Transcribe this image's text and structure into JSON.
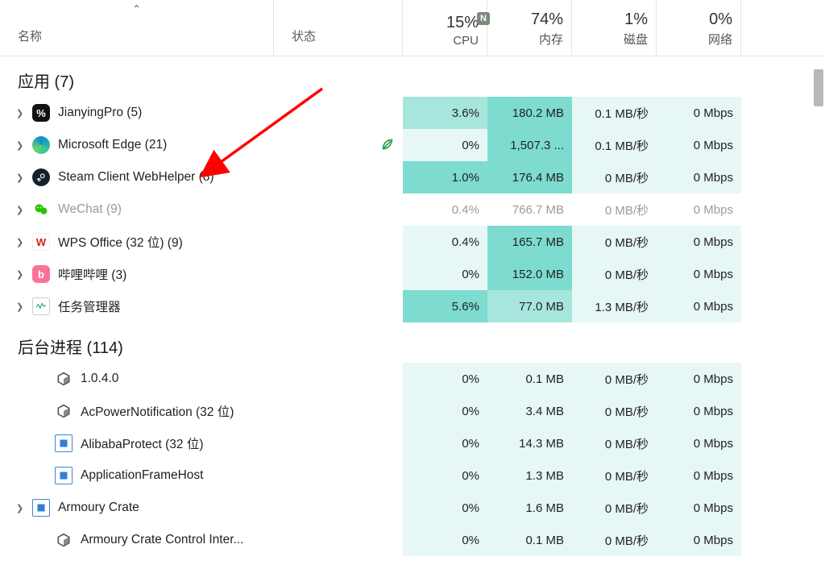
{
  "columns": {
    "name": "名称",
    "status": "状态",
    "cpu": {
      "pct": "15%",
      "label": "CPU",
      "badge": "N"
    },
    "mem": {
      "pct": "74%",
      "label": "内存"
    },
    "disk": {
      "pct": "1%",
      "label": "磁盘"
    },
    "net": {
      "pct": "0%",
      "label": "网络"
    }
  },
  "groups": {
    "apps": {
      "label": "应用 (7)"
    },
    "bg": {
      "label": "后台进程 (114)"
    }
  },
  "apps": [
    {
      "name": "JianyingPro (5)",
      "icon": {
        "bg": "#111",
        "txt": "%",
        "radius": "6px"
      },
      "cpu": "3.6%",
      "cpuHeat": "heat-3",
      "mem": "180.2 MB",
      "memHeat": "heat-4",
      "disk": "0.1 MB/秒",
      "diskHeat": "heat-1",
      "net": "0 Mbps",
      "netHeat": "heat-1",
      "expand": true,
      "leaf": false,
      "dim": false
    },
    {
      "name": "Microsoft Edge (21)",
      "icon": {
        "bg": "linear-gradient(135deg,#0b79d0,#2ecc71)",
        "txt": "",
        "radius": "50%",
        "edge": true
      },
      "cpu": "0%",
      "cpuHeat": "heat-1",
      "mem": "1,507.3 ...",
      "memHeat": "heat-4",
      "disk": "0.1 MB/秒",
      "diskHeat": "heat-1",
      "net": "0 Mbps",
      "netHeat": "heat-1",
      "expand": true,
      "leaf": true,
      "dim": false
    },
    {
      "name": "Steam Client WebHelper (8)",
      "icon": {
        "bg": "#14202b",
        "txt": "",
        "radius": "50%",
        "steam": true
      },
      "cpu": "1.0%",
      "cpuHeat": "heat-4",
      "mem": "176.4 MB",
      "memHeat": "heat-4",
      "disk": "0 MB/秒",
      "diskHeat": "heat-1",
      "net": "0 Mbps",
      "netHeat": "heat-1",
      "expand": true,
      "leaf": false,
      "dim": false
    },
    {
      "name": "WeChat (9)",
      "icon": {
        "bg": "#2dc100",
        "txt": "",
        "radius": "6px",
        "wechat": true
      },
      "cpu": "0.4%",
      "cpuHeat": "heat-0",
      "mem": "766.7 MB",
      "memHeat": "heat-0",
      "disk": "0 MB/秒",
      "diskHeat": "heat-0",
      "net": "0 Mbps",
      "netHeat": "heat-0",
      "expand": true,
      "leaf": false,
      "dim": true
    },
    {
      "name": "WPS Office (32 位) (9)",
      "icon": {
        "bg": "#fff",
        "txt": "W",
        "radius": "4px",
        "wps": true
      },
      "cpu": "0.4%",
      "cpuHeat": "heat-1",
      "mem": "165.7 MB",
      "memHeat": "heat-4",
      "disk": "0 MB/秒",
      "diskHeat": "heat-1",
      "net": "0 Mbps",
      "netHeat": "heat-1",
      "expand": true,
      "leaf": false,
      "dim": false
    },
    {
      "name": "哔哩哔哩 (3)",
      "icon": {
        "bg": "#fb7299",
        "txt": "b",
        "radius": "6px"
      },
      "cpu": "0%",
      "cpuHeat": "heat-1",
      "mem": "152.0 MB",
      "memHeat": "heat-4",
      "disk": "0 MB/秒",
      "diskHeat": "heat-1",
      "net": "0 Mbps",
      "netHeat": "heat-1",
      "expand": true,
      "leaf": false,
      "dim": false
    },
    {
      "name": "任务管理器",
      "icon": {
        "bg": "#fff",
        "txt": "",
        "radius": "4px",
        "tm": true
      },
      "cpu": "5.6%",
      "cpuHeat": "heat-4",
      "mem": "77.0 MB",
      "memHeat": "heat-3",
      "disk": "1.3 MB/秒",
      "diskHeat": "heat-1",
      "net": "0 Mbps",
      "netHeat": "heat-1",
      "expand": true,
      "leaf": false,
      "dim": false
    }
  ],
  "bg": [
    {
      "name": "1.0.4.0",
      "icon": {
        "cube": true
      },
      "cpu": "0%",
      "cpuHeat": "heat-1",
      "mem": "0.1 MB",
      "memHeat": "heat-1",
      "disk": "0 MB/秒",
      "diskHeat": "heat-1",
      "net": "0 Mbps",
      "netHeat": "heat-1",
      "expand": false
    },
    {
      "name": "AcPowerNotification (32 位)",
      "icon": {
        "cube": true
      },
      "cpu": "0%",
      "cpuHeat": "heat-1",
      "mem": "3.4 MB",
      "memHeat": "heat-1",
      "disk": "0 MB/秒",
      "diskHeat": "heat-1",
      "net": "0 Mbps",
      "netHeat": "heat-1",
      "expand": false
    },
    {
      "name": "AlibabaProtect (32 位)",
      "icon": {
        "win": true
      },
      "cpu": "0%",
      "cpuHeat": "heat-1",
      "mem": "14.3 MB",
      "memHeat": "heat-1",
      "disk": "0 MB/秒",
      "diskHeat": "heat-1",
      "net": "0 Mbps",
      "netHeat": "heat-1",
      "expand": false
    },
    {
      "name": "ApplicationFrameHost",
      "icon": {
        "win": true
      },
      "cpu": "0%",
      "cpuHeat": "heat-1",
      "mem": "1.3 MB",
      "memHeat": "heat-1",
      "disk": "0 MB/秒",
      "diskHeat": "heat-1",
      "net": "0 Mbps",
      "netHeat": "heat-1",
      "expand": false
    },
    {
      "name": "Armoury Crate",
      "icon": {
        "win": true
      },
      "cpu": "0%",
      "cpuHeat": "heat-1",
      "mem": "1.6 MB",
      "memHeat": "heat-1",
      "disk": "0 MB/秒",
      "diskHeat": "heat-1",
      "net": "0 Mbps",
      "netHeat": "heat-1",
      "expand": true
    },
    {
      "name": "Armoury Crate Control Inter...",
      "icon": {
        "cube": true
      },
      "cpu": "0%",
      "cpuHeat": "heat-1",
      "mem": "0.1 MB",
      "memHeat": "heat-1",
      "disk": "0 MB/秒",
      "diskHeat": "heat-1",
      "net": "0 Mbps",
      "netHeat": "heat-1",
      "expand": false
    }
  ]
}
